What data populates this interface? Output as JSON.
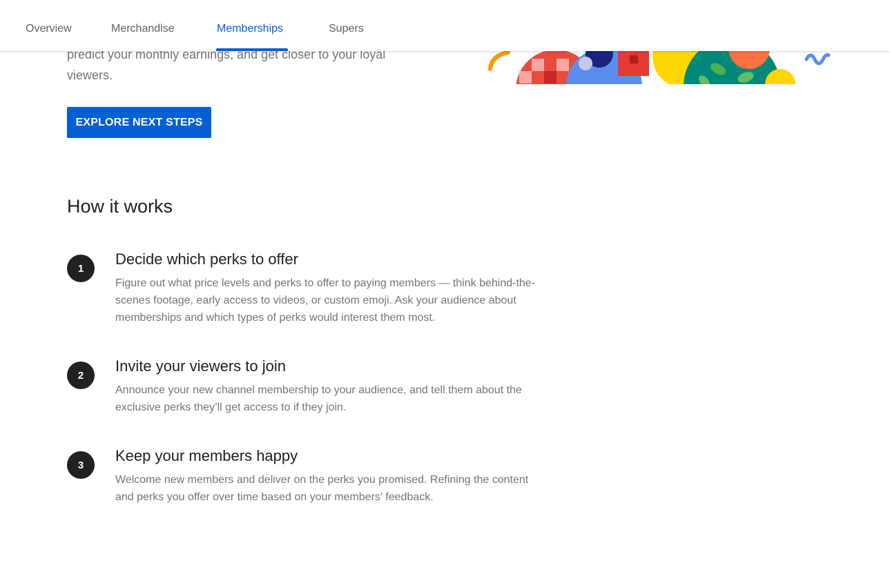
{
  "tabs": [
    {
      "label": "Overview",
      "active": false
    },
    {
      "label": "Merchandise",
      "active": false
    },
    {
      "label": "Memberships",
      "active": true
    },
    {
      "label": "Supers",
      "active": false
    }
  ],
  "hero": {
    "description_fragment": "predict your monthly earnings, and get closer to your loyal viewers.",
    "cta_label": "EXPLORE NEXT STEPS"
  },
  "how_it_works": {
    "title": "How it works",
    "steps": [
      {
        "number": "1",
        "title": "Decide which perks to offer",
        "description": "Figure out what price levels and perks to offer to paying members — think behind-the-scenes footage, early access to videos, or custom emoji. Ask your audience about memberships and which types of perks would interest them most."
      },
      {
        "number": "2",
        "title": "Invite your viewers to join",
        "description": "Announce your new channel membership to your audience, and tell them about the exclusive perks they’ll get access to if they join."
      },
      {
        "number": "3",
        "title": "Keep your members happy",
        "description": "Welcome new members and deliver on the perks you promised. Refining the content and perks you offer over time based on your members’ feedback."
      }
    ]
  },
  "colors": {
    "accent": "#065fd4",
    "text_primary": "#212121",
    "text_secondary": "#757575",
    "tab_inactive": "#606060"
  }
}
